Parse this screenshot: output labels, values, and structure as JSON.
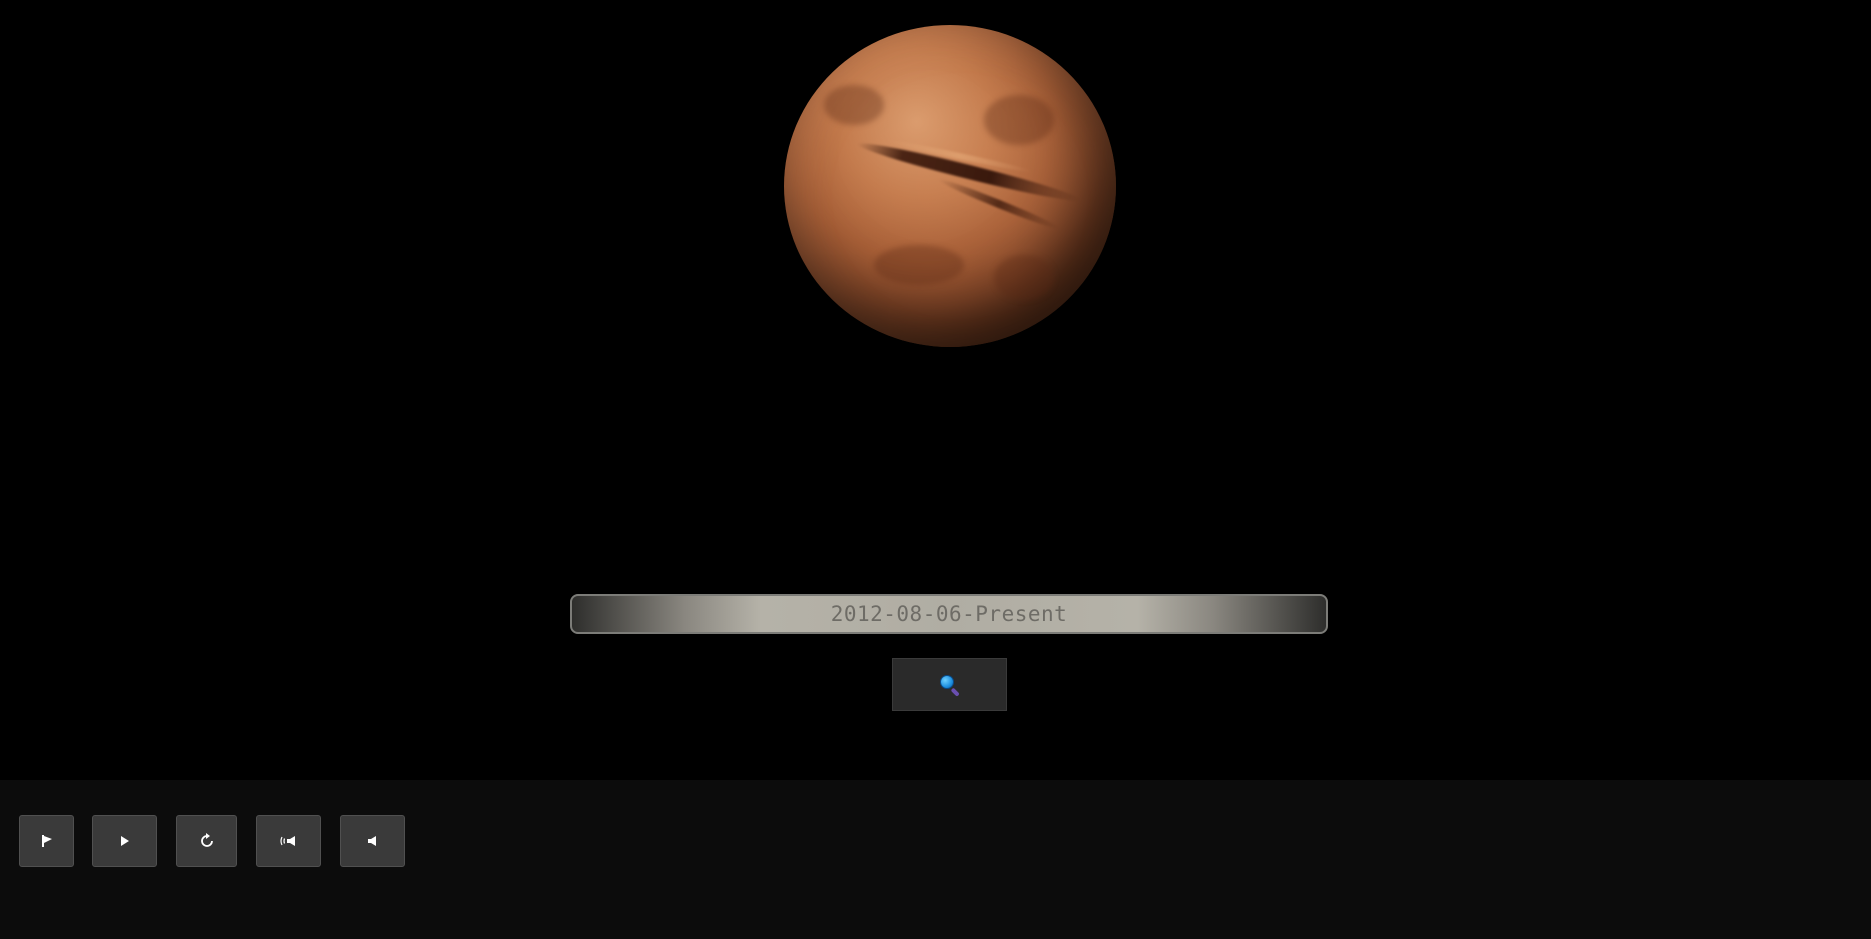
{
  "date_range": {
    "value": "2012-08-06-Present"
  },
  "search": {
    "icon": "magnifier-icon"
  },
  "controls": [
    {
      "name": "flag-icon",
      "glyph": "⚑"
    },
    {
      "name": "play-icon",
      "glyph": "▶"
    },
    {
      "name": "replay-icon",
      "glyph": "↺"
    },
    {
      "name": "speaker-sound-icon",
      "glyph": "((▶"
    },
    {
      "name": "speaker-icon",
      "glyph": "◂"
    }
  ],
  "colors": {
    "background": "#000000",
    "control_bar": "#0c0c0c",
    "button": "#3a3a3a",
    "planet": "#c37a4c"
  }
}
